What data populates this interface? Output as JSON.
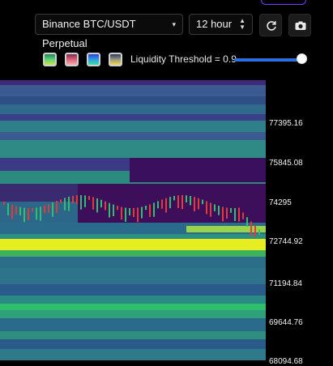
{
  "toolbar": {
    "market_select": {
      "value": "Binance BTC/USDT Perpetual"
    },
    "interval_select": {
      "value": "12 hour"
    },
    "refresh_icon": "refresh-icon",
    "screenshot_icon": "camera-icon",
    "swatches": [
      {
        "name": "viridis",
        "colors": [
          "#1b8a5a",
          "#5fd17a",
          "#c8e84a"
        ]
      },
      {
        "name": "magma",
        "colors": [
          "#7a2a4a",
          "#e0607a",
          "#f4b0b0"
        ]
      },
      {
        "name": "blue-green",
        "colors": [
          "#2a3fd6",
          "#2f9de6",
          "#3ee0a0"
        ]
      },
      {
        "name": "cividis",
        "colors": [
          "#2c3a6b",
          "#9a9a7a",
          "#f2d75a"
        ]
      }
    ],
    "threshold": {
      "label": "Liquidity Threshold = 0.9",
      "value": 0.9
    },
    "accent_color": "#2a6fe0"
  },
  "axis": {
    "labels": [
      "77395.16",
      "75845.08",
      "74295",
      "72744.92",
      "71194.84",
      "69644.76",
      "68094.68"
    ]
  },
  "heatmap": {
    "colors": {
      "low": "#3a0a5a",
      "mid": "#2a7a8a",
      "high": "#f0f020"
    },
    "candle_colors": {
      "up": "#2fbf71",
      "down": "#e23a3a"
    }
  }
}
